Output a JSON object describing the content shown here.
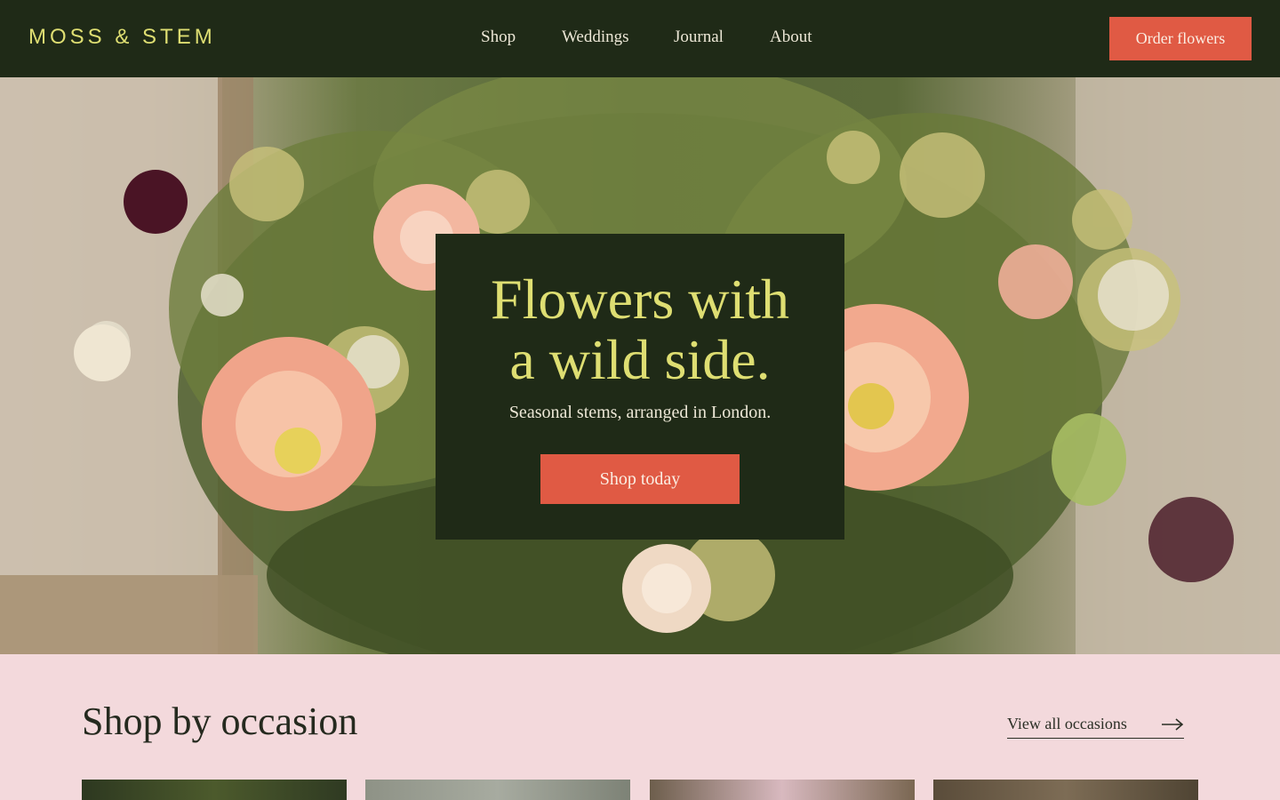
{
  "header": {
    "logo": "MOSS & STEM",
    "nav": [
      "Shop",
      "Weddings",
      "Journal",
      "About"
    ],
    "cta": "Order flowers"
  },
  "hero": {
    "title_line1": "Flowers with",
    "title_line2": "a wild side.",
    "subtitle": "Seasonal stems, arranged in London.",
    "button": "Shop today"
  },
  "occasions": {
    "title": "Shop by occasion",
    "view_all": "View all occasions"
  },
  "colors": {
    "dark_green": "#1f2a17",
    "accent_yellow": "#dede72",
    "coral": "#e05a44",
    "blush": "#f3d9dc"
  }
}
